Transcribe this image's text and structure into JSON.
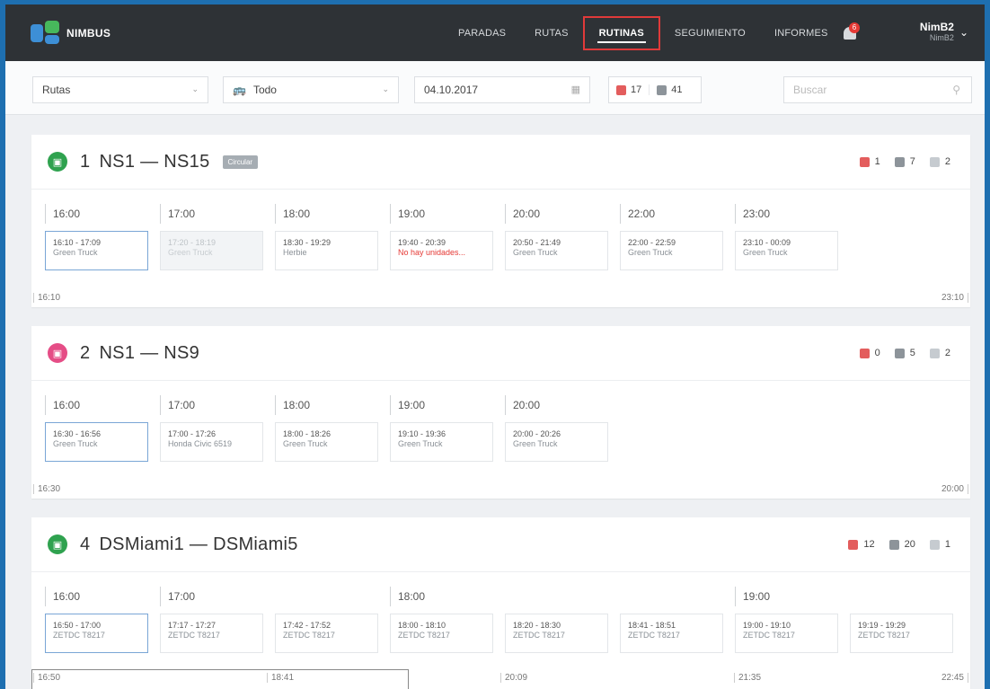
{
  "nav": {
    "brand": "NIMBUS",
    "items": [
      "PARADAS",
      "RUTAS",
      "RUTINAS",
      "SEGUIMIENTO",
      "INFORMES"
    ],
    "active": "RUTINAS",
    "bell_count": "6",
    "user_name": "NimB2",
    "user_sub": "NimB2"
  },
  "filters": {
    "routes_select": "Rutas",
    "vehicle_select": "Todo",
    "date": "04.10.2017",
    "count_alert": "17",
    "count_ok": "41",
    "search_placeholder": "Buscar"
  },
  "colors": {
    "accent_red": "#e03a3a",
    "green": "#2fa24f",
    "pink": "#e54d86",
    "blue_bg": "#1e6fb0"
  },
  "routes": [
    {
      "num": "1",
      "name": "NS1 — NS15",
      "badge": "Circular",
      "icon_color": "green",
      "stats": {
        "alert": "1",
        "ok": "7",
        "vehicles": "2"
      },
      "hours": [
        "16:00",
        "17:00",
        "18:00",
        "19:00",
        "20:00",
        "22:00",
        "23:00"
      ],
      "slots": [
        {
          "time": "16:10 - 17:09",
          "driver": "Green Truck"
        },
        {
          "time": "17:20 - 18:19",
          "driver": "Green Truck"
        },
        {
          "time": "18:30 - 19:29",
          "driver": "Herbie"
        },
        {
          "time": "19:40 - 20:39",
          "driver": "No hay unidades..."
        },
        {
          "time": "20:50 - 21:49",
          "driver": "Green Truck"
        },
        {
          "time": "22:00 - 22:59",
          "driver": "Green Truck"
        },
        {
          "time": "23:10 - 00:09",
          "driver": "Green Truck"
        }
      ],
      "scale_start": "16:10",
      "scale_end": "23:10"
    },
    {
      "num": "2",
      "name": "NS1 — NS9",
      "icon_color": "pink",
      "stats": {
        "alert": "0",
        "ok": "5",
        "vehicles": "2"
      },
      "hours": [
        "16:00",
        "17:00",
        "18:00",
        "19:00",
        "20:00"
      ],
      "slots": [
        {
          "time": "16:30 - 16:56",
          "driver": "Green Truck"
        },
        {
          "time": "17:00 - 17:26",
          "driver": "Honda Civic 6519"
        },
        {
          "time": "18:00 - 18:26",
          "driver": "Green Truck"
        },
        {
          "time": "19:10 - 19:36",
          "driver": "Green Truck"
        },
        {
          "time": "20:00 - 20:26",
          "driver": "Green Truck"
        }
      ],
      "scale_start": "16:30",
      "scale_end": "20:00"
    },
    {
      "num": "4",
      "name": "DSMiami1 — DSMiami5",
      "icon_color": "green",
      "stats": {
        "alert": "12",
        "ok": "20",
        "vehicles": "1"
      },
      "hours": [
        "16:00",
        "17:00",
        "18:00",
        "19:00"
      ],
      "slots": [
        {
          "time": "16:50 - 17:00",
          "driver": "ZETDC T8217"
        },
        {
          "time": "17:17 - 17:27",
          "driver": "ZETDC T8217"
        },
        {
          "time": "17:42 - 17:52",
          "driver": "ZETDC T8217"
        },
        {
          "time": "18:00 - 18:10",
          "driver": "ZETDC T8217"
        },
        {
          "time": "18:20 - 18:30",
          "driver": "ZETDC T8217"
        },
        {
          "time": "18:41 - 18:51",
          "driver": "ZETDC T8217"
        },
        {
          "time": "19:00 - 19:10",
          "driver": "ZETDC T8217"
        },
        {
          "time": "19:19 - 19:29",
          "driver": "ZETDC T8217"
        }
      ],
      "scale_marks": [
        "16:50",
        "18:41",
        "20:09",
        "21:35",
        "22:45"
      ]
    }
  ]
}
